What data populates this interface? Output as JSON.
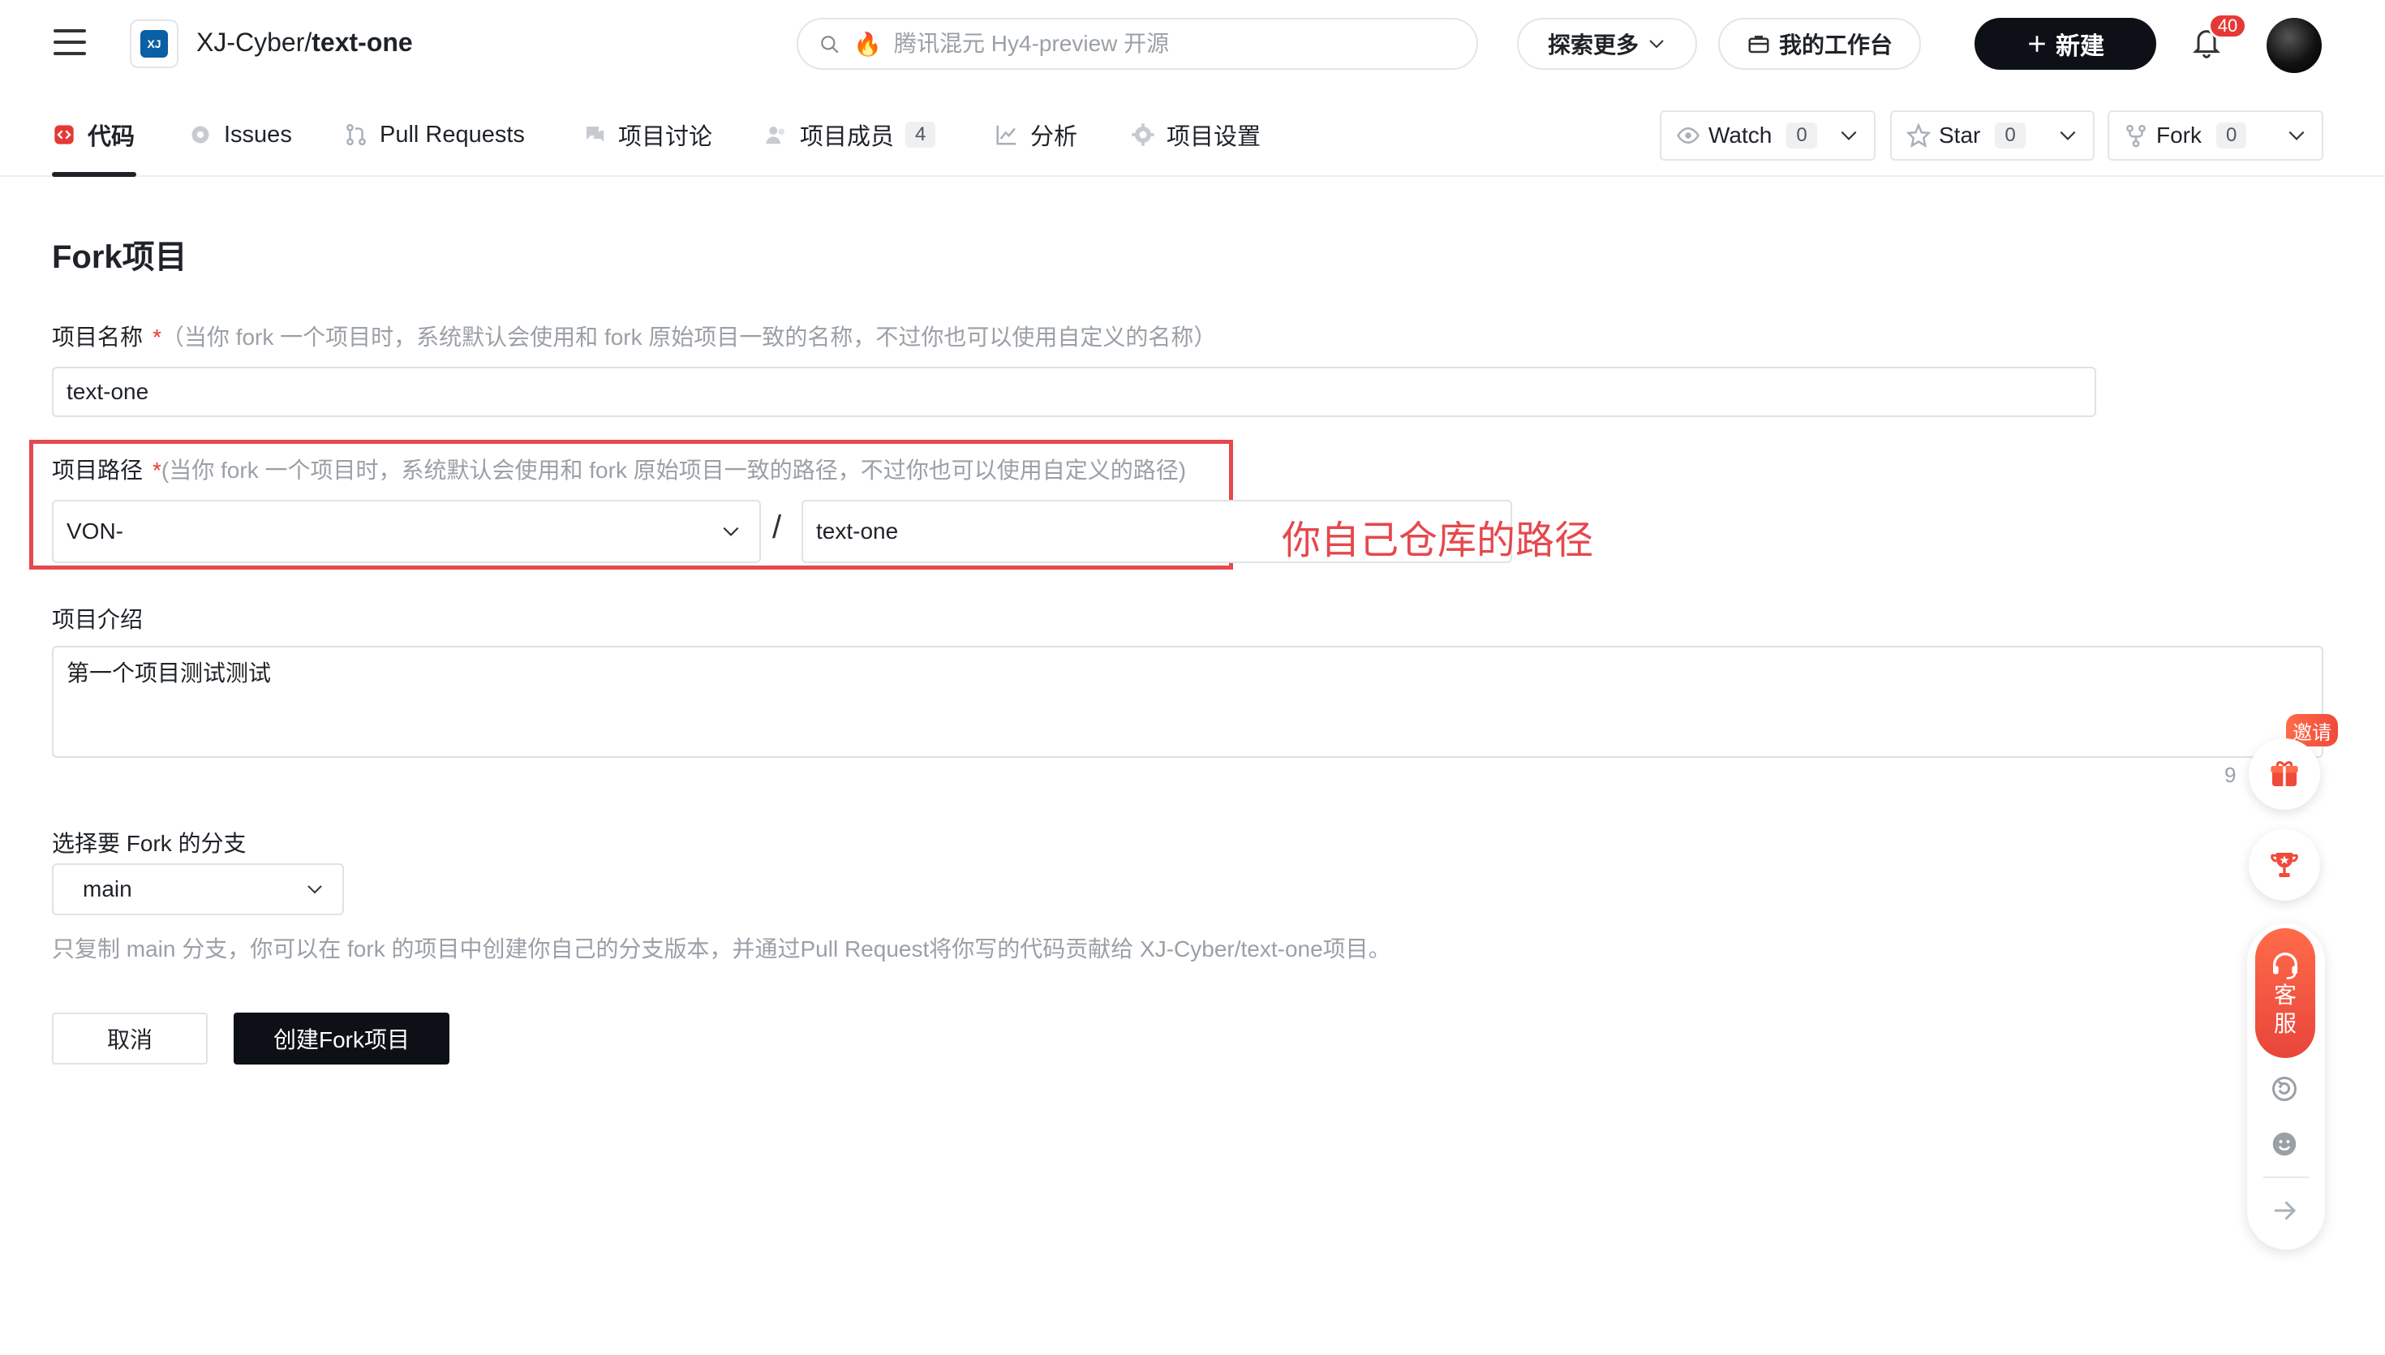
{
  "header": {
    "repo_owner": "XJ-Cyber/",
    "repo_name": "text-one",
    "search_placeholder": "腾讯混元 Hy4-preview 开源",
    "explore_label": "探索更多",
    "workbench_label": "我的工作台",
    "new_label": "新建",
    "notification_count": "40"
  },
  "tabs": [
    {
      "label": "代码",
      "active": true
    },
    {
      "label": "Issues"
    },
    {
      "label": "Pull Requests"
    },
    {
      "label": "项目讨论"
    },
    {
      "label": "项目成员",
      "count": "4"
    },
    {
      "label": "分析"
    },
    {
      "label": "项目设置"
    }
  ],
  "actions": {
    "watch": {
      "label": "Watch",
      "count": "0"
    },
    "star": {
      "label": "Star",
      "count": "0"
    },
    "fork": {
      "label": "Fork",
      "count": "0"
    }
  },
  "form": {
    "title": "Fork项目",
    "name_label": "项目名称",
    "required_mark": "*",
    "name_hint": "（当你 fork 一个项目时，系统默认会使用和 fork 原始项目一致的名称，不过你也可以使用自定义的名称）",
    "name_value": "text-one",
    "path_label": "项目路径",
    "path_hint": "(当你 fork 一个项目时，系统默认会使用和 fork 原始项目一致的路径，不过你也可以使用自定义的路径)",
    "path_namespace": "VON-",
    "path_separator": "/",
    "path_value": "text-one",
    "annotation": "你自己仓库的路径",
    "desc_label": "项目介绍",
    "desc_value": "第一个项目测试测试",
    "desc_char_count": "9",
    "branch_label": "选择要 Fork 的分支",
    "branch_value": "main",
    "branch_help": "只复制 main 分支，你可以在 fork 的项目中创建你自己的分支版本，并通过Pull Request将你写的代码贡献给 XJ-Cyber/text-one项目。",
    "cancel_label": "取消",
    "create_label": "创建Fork项目"
  },
  "floating": {
    "invite_label": "邀请",
    "service_label_1": "客",
    "service_label_2": "服"
  },
  "colors": {
    "accent_red": "#e5484d",
    "primary_dark": "#0d1117",
    "hint_gray": "#9aa0a6"
  },
  "icons": [
    "menu-icon",
    "search-icon",
    "fire-icon",
    "briefcase-icon",
    "plus-icon",
    "bell-icon",
    "code-icon",
    "issues-icon",
    "pull-request-icon",
    "discussion-icon",
    "members-icon",
    "analytics-icon",
    "settings-icon",
    "eye-icon",
    "star-icon",
    "fork-icon",
    "gift-icon",
    "trophy-icon",
    "headset-icon",
    "refresh-icon",
    "smile-icon",
    "arrow-right-icon"
  ]
}
